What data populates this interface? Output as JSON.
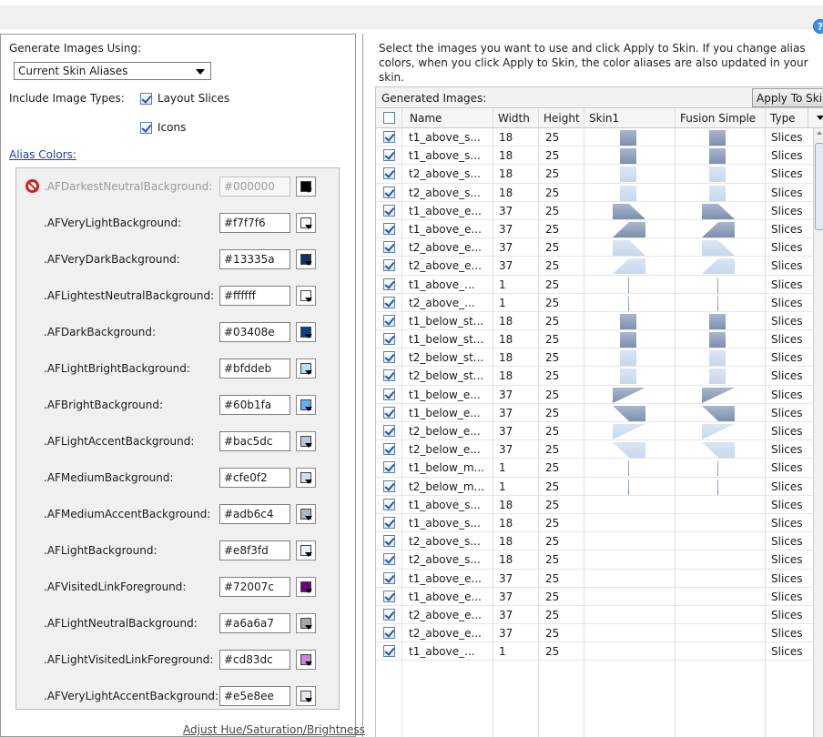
{
  "left": {
    "generate_label": "Generate Images Using:",
    "select_value": "Current Skin Aliases",
    "include_label": "Include Image Types:",
    "layout_slices": "Layout Slices",
    "icons": "Icons",
    "alias_colors_link": "Alias Colors:",
    "adjust_link": "Adjust Hue/Saturation/Brightness",
    "aliases": [
      {
        "name": ".AFDarkestNeutralBackground:",
        "hex": "#000000",
        "color": "#000000",
        "disabled": true
      },
      {
        "name": ".AFVeryLightBackground:",
        "hex": "#f7f7f6",
        "color": "#f7f7f6"
      },
      {
        "name": ".AFVeryDarkBackground:",
        "hex": "#13335a",
        "color": "#13335a"
      },
      {
        "name": ".AFLightestNeutralBackground:",
        "hex": "#ffffff",
        "color": "#ffffff"
      },
      {
        "name": ".AFDarkBackground:",
        "hex": "#03408e",
        "color": "#03408e"
      },
      {
        "name": ".AFLightBrightBackground:",
        "hex": "#bfddeb",
        "color": "#bfddeb"
      },
      {
        "name": ".AFBrightBackground:",
        "hex": "#60b1fa",
        "color": "#60b1fa"
      },
      {
        "name": ".AFLightAccentBackground:",
        "hex": "#bac5dc",
        "color": "#bac5dc"
      },
      {
        "name": ".AFMediumBackground:",
        "hex": "#cfe0f2",
        "color": "#cfe0f2"
      },
      {
        "name": ".AFMediumAccentBackground:",
        "hex": "#adb6c4",
        "color": "#adb6c4"
      },
      {
        "name": ".AFLightBackground:",
        "hex": "#e8f3fd",
        "color": "#e8f3fd"
      },
      {
        "name": ".AFVisitedLinkForeground:",
        "hex": "#72007c",
        "color": "#72007c"
      },
      {
        "name": ".AFLightNeutralBackground:",
        "hex": "#a6a6a7",
        "color": "#a6a6a7"
      },
      {
        "name": ".AFLightVisitedLinkForeground:",
        "hex": "#cd83dc",
        "color": "#cd83dc"
      },
      {
        "name": ".AFVeryLightAccentBackground:",
        "hex": "#e5e8ee",
        "color": "#e5e8ee"
      }
    ]
  },
  "right": {
    "instructions": "Select the images you want to use and click Apply to Skin. If you change alias colors, when you click Apply to Skin, the color aliases are also updated in your skin.",
    "generated_label": "Generated Images:",
    "apply_button": "Apply To Skin",
    "columns": {
      "name": "Name",
      "width": "Width",
      "height": "Height",
      "skin1": "Skin1",
      "fusion": "Fusion Simple",
      "type": "Type"
    },
    "rows": [
      {
        "name": "t1_above_s...",
        "width": "18",
        "height": "25",
        "type": "Slices",
        "img": "sq"
      },
      {
        "name": "t1_above_s...",
        "width": "18",
        "height": "25",
        "type": "Slices",
        "img": "sq"
      },
      {
        "name": "t2_above_s...",
        "width": "18",
        "height": "25",
        "type": "Slices",
        "img": "sql"
      },
      {
        "name": "t2_above_s...",
        "width": "18",
        "height": "25",
        "type": "Slices",
        "img": "sql"
      },
      {
        "name": "t1_above_e...",
        "width": "37",
        "height": "25",
        "type": "Slices",
        "img": "tr1"
      },
      {
        "name": "t1_above_e...",
        "width": "37",
        "height": "25",
        "type": "Slices",
        "img": "tr2"
      },
      {
        "name": "t2_above_e...",
        "width": "37",
        "height": "25",
        "type": "Slices",
        "img": "tr1l"
      },
      {
        "name": "t2_above_e...",
        "width": "37",
        "height": "25",
        "type": "Slices",
        "img": "tr2l"
      },
      {
        "name": "t1_above_...",
        "width": "1",
        "height": "25",
        "type": "Slices",
        "img": "line"
      },
      {
        "name": "t2_above_...",
        "width": "1",
        "height": "25",
        "type": "Slices",
        "img": "line"
      },
      {
        "name": "t1_below_st...",
        "width": "18",
        "height": "25",
        "type": "Slices",
        "img": "sq"
      },
      {
        "name": "t1_below_st...",
        "width": "18",
        "height": "25",
        "type": "Slices",
        "img": "sq"
      },
      {
        "name": "t2_below_st...",
        "width": "18",
        "height": "25",
        "type": "Slices",
        "img": "sql"
      },
      {
        "name": "t2_below_st...",
        "width": "18",
        "height": "25",
        "type": "Slices",
        "img": "sql"
      },
      {
        "name": "t1_below_e...",
        "width": "37",
        "height": "25",
        "type": "Slices",
        "img": "tr3"
      },
      {
        "name": "t1_below_e...",
        "width": "37",
        "height": "25",
        "type": "Slices",
        "img": "tr4"
      },
      {
        "name": "t2_below_e...",
        "width": "37",
        "height": "25",
        "type": "Slices",
        "img": "tr3l"
      },
      {
        "name": "t2_below_e...",
        "width": "37",
        "height": "25",
        "type": "Slices",
        "img": "tr4l"
      },
      {
        "name": "t1_below_m...",
        "width": "1",
        "height": "25",
        "type": "Slices",
        "img": "line"
      },
      {
        "name": "t2_below_m...",
        "width": "1",
        "height": "25",
        "type": "Slices",
        "img": "line"
      },
      {
        "name": "t1_above_s...",
        "width": "18",
        "height": "25",
        "type": "Slices",
        "img": ""
      },
      {
        "name": "t1_above_s...",
        "width": "18",
        "height": "25",
        "type": "Slices",
        "img": ""
      },
      {
        "name": "t2_above_s...",
        "width": "18",
        "height": "25",
        "type": "Slices",
        "img": ""
      },
      {
        "name": "t2_above_s...",
        "width": "18",
        "height": "25",
        "type": "Slices",
        "img": ""
      },
      {
        "name": "t1_above_e...",
        "width": "37",
        "height": "25",
        "type": "Slices",
        "img": ""
      },
      {
        "name": "t1_above_e...",
        "width": "37",
        "height": "25",
        "type": "Slices",
        "img": ""
      },
      {
        "name": "t2_above_e...",
        "width": "37",
        "height": "25",
        "type": "Slices",
        "img": ""
      },
      {
        "name": "t2_above_e...",
        "width": "37",
        "height": "25",
        "type": "Slices",
        "img": ""
      },
      {
        "name": "t1_above_...",
        "width": "1",
        "height": "25",
        "type": "Slices",
        "img": ""
      }
    ]
  },
  "icons": {
    "help": "help-icon",
    "disabled": "no-entry-icon"
  },
  "colors": {
    "link": "#1d3fbf",
    "check": "#2256b0",
    "thumb_dark": "#7b8fae",
    "thumb_light": "#c6d8ee"
  }
}
